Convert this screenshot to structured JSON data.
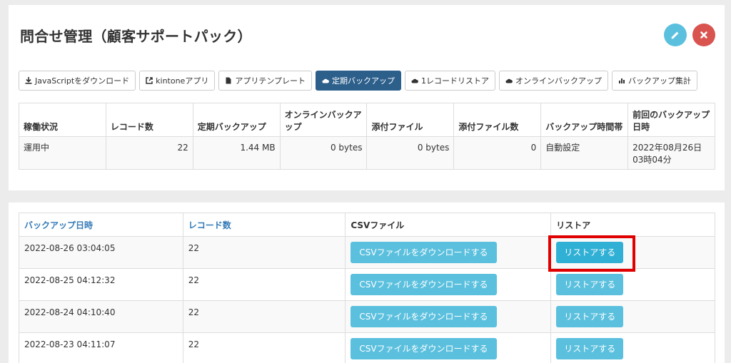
{
  "header": {
    "title": "問合せ管理（顧客サポートパック）"
  },
  "toolbar": [
    {
      "label": "JavaScriptをダウンロード",
      "icon": "download-icon",
      "active": false
    },
    {
      "label": "kintoneアプリ",
      "icon": "external-link-icon",
      "active": false
    },
    {
      "label": "アプリテンプレート",
      "icon": "file-icon",
      "active": false
    },
    {
      "label": "定期バックアップ",
      "icon": "cloud-icon",
      "active": true
    },
    {
      "label": "1レコードリストア",
      "icon": "cloud-icon",
      "active": false
    },
    {
      "label": "オンラインバックアップ",
      "icon": "cloud-icon",
      "active": false
    },
    {
      "label": "バックアップ集計",
      "icon": "bar-chart-icon",
      "active": false
    }
  ],
  "status_table": {
    "headers": [
      "稼働状況",
      "レコード数",
      "定期バックアップ",
      "オンラインバックアップ",
      "添付ファイル",
      "添付ファイル数",
      "バックアップ時間帯",
      "前回のバックアップ日時"
    ],
    "row": [
      "運用中",
      "22",
      "1.44 MB",
      "0 bytes",
      "0 bytes",
      "0",
      "自動設定",
      "2022年08月26日03時04分"
    ]
  },
  "backup_table": {
    "headers": {
      "date": "バックアップ日時",
      "records": "レコード数",
      "csv": "CSVファイル",
      "restore": "リストア"
    },
    "rows": [
      {
        "date": "2022-08-26 03:04:05",
        "records": "22"
      },
      {
        "date": "2022-08-25 04:12:32",
        "records": "22"
      },
      {
        "date": "2022-08-24 04:10:40",
        "records": "22"
      },
      {
        "date": "2022-08-23 04:11:07",
        "records": "22"
      }
    ],
    "csv_button_label": "CSVファイルをダウンロードする",
    "restore_button_label": "リストアする"
  },
  "colors": {
    "active_tab": "#2d5f8b",
    "info_button": "#5bc0de",
    "danger_button": "#d9534f",
    "highlight": "#e00000",
    "link": "#337ab7"
  }
}
